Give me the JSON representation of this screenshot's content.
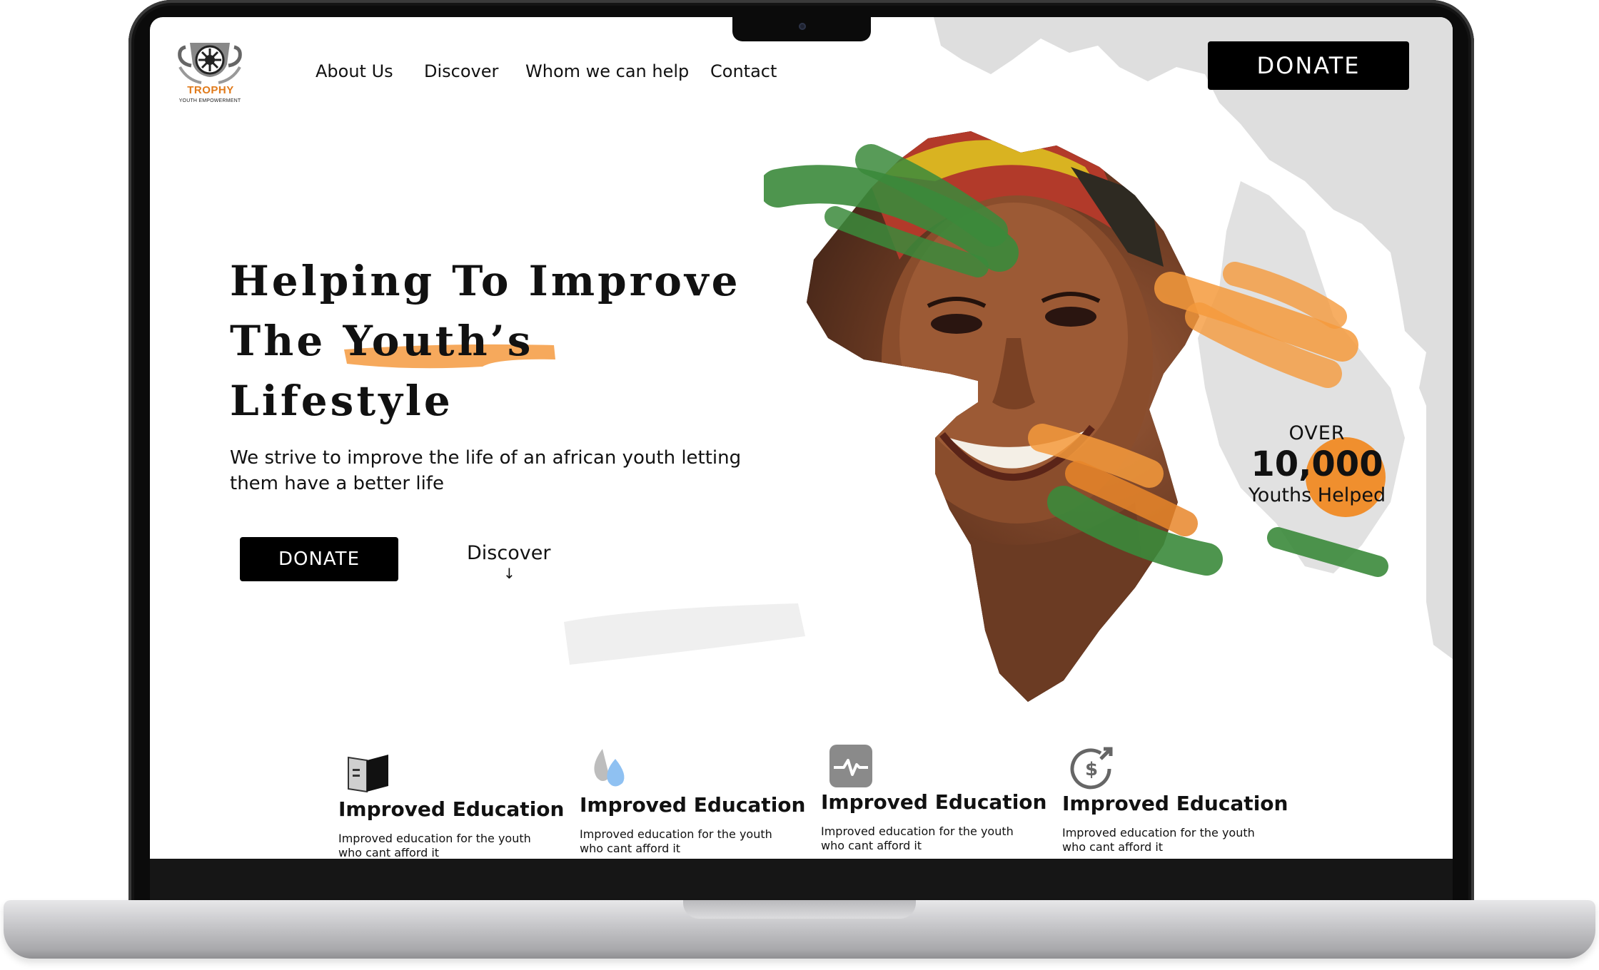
{
  "logo": {
    "name": "TROPHY",
    "tagline": "YOUTH EMPOWERMENT"
  },
  "nav": {
    "items": [
      {
        "label": "About Us"
      },
      {
        "label": "Discover"
      },
      {
        "label": "Whom we can help"
      },
      {
        "label": "Contact"
      }
    ]
  },
  "header": {
    "donate_label": "DONATE"
  },
  "hero": {
    "title_line1": "Helping To Improve",
    "title_line2_prefix": "The ",
    "title_line2_highlight": "Youth’s",
    "title_line3": "Lifestyle",
    "subtitle": "We strive to improve the life of an african youth letting them have a better life",
    "donate_label": "DONATE",
    "discover_label": "Discover",
    "discover_arrow": "↓"
  },
  "stats": {
    "over_label": "OVER",
    "number": "10,000",
    "label": "Youths Helped"
  },
  "features": [
    {
      "icon": "book-icon",
      "title": "Improved Education",
      "desc": "Improved education for the youth who cant afford it"
    },
    {
      "icon": "water-drop-icon",
      "title": "Improved Education",
      "desc": "Improved education for the youth who cant afford it"
    },
    {
      "icon": "heartbeat-icon",
      "title": "Improved Education",
      "desc": "Improved education for the youth who cant afford it"
    },
    {
      "icon": "dollar-growth-icon",
      "title": "Improved Education",
      "desc": "Improved education for the youth who cant afford it"
    }
  ],
  "colors": {
    "accent_orange": "#f5a04a",
    "accent_green": "#3f8a3f",
    "button_black": "#000000",
    "map_gray": "#dedede"
  }
}
